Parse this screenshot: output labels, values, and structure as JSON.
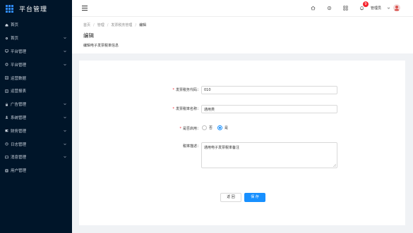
{
  "app": {
    "title": "平台管理"
  },
  "sidebar": {
    "items": [
      {
        "label": "首页",
        "icon": "home-icon",
        "has_arrow": false
      },
      {
        "label": "首页",
        "icon": "settings-icon",
        "has_arrow": true
      },
      {
        "label": "平台管理",
        "icon": "monitor-icon",
        "has_arrow": true
      },
      {
        "label": "平台管理",
        "icon": "cog-icon",
        "has_arrow": true
      },
      {
        "label": "运营数据",
        "icon": "chart-icon",
        "has_arrow": false
      },
      {
        "label": "运营报表",
        "icon": "report-icon",
        "has_arrow": false
      },
      {
        "label": "广告管理",
        "icon": "lock-icon",
        "has_arrow": true
      },
      {
        "label": "系统管理",
        "icon": "user-icon",
        "has_arrow": true
      },
      {
        "label": "财务管理",
        "icon": "wallet-icon",
        "has_arrow": true
      },
      {
        "label": "日志管理",
        "icon": "log-icon",
        "has_arrow": true
      },
      {
        "label": "消息管理",
        "icon": "message-icon",
        "has_arrow": true
      },
      {
        "label": "用户管理",
        "icon": "users-icon",
        "has_arrow": false
      }
    ]
  },
  "header": {
    "notification_count": "9",
    "username": "管理员"
  },
  "breadcrumb": {
    "items": [
      "首页",
      "管理",
      "发票税务管理"
    ],
    "current": "编辑"
  },
  "page": {
    "title": "编辑",
    "subtitle": "编辑电子发票税率信息"
  },
  "form": {
    "field1": {
      "label": "发票税务代码：",
      "value": "010",
      "required": true
    },
    "field2": {
      "label": "发票税率名称：",
      "value": "通用类",
      "required": true
    },
    "field3": {
      "label": "是否启用：",
      "required": true,
      "options": [
        {
          "label": "否",
          "checked": false
        },
        {
          "label": "是",
          "checked": true
        }
      ]
    },
    "field4": {
      "label": "税率描述：",
      "value": "通用电子发票税率备注"
    }
  },
  "buttons": {
    "back": "返 回",
    "save": "保 存"
  },
  "colors": {
    "sidebar_bg": "#001529",
    "primary": "#1890ff",
    "badge": "#f5222d"
  }
}
